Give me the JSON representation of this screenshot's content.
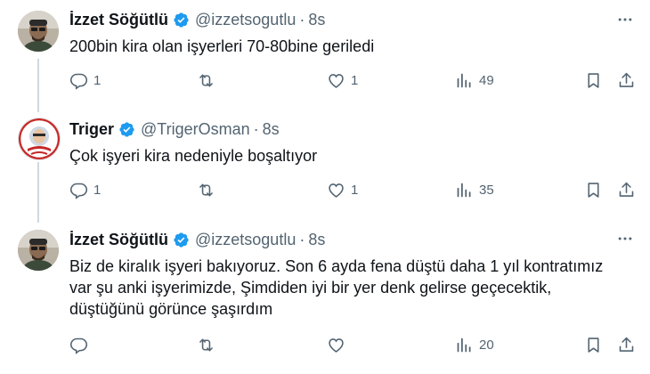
{
  "colors": {
    "verified": "#1d9bf0",
    "muted": "#536471",
    "thread_line": "#cfd9de"
  },
  "tweets": [
    {
      "name": "İzzet Söğütlü",
      "handle": "@izzetsogutlu",
      "dot": "·",
      "time": "8s",
      "text": "200bin kira olan işyerleri 70-80bine geriledi",
      "replies": "1",
      "retweets": "",
      "likes": "1",
      "views": "49"
    },
    {
      "name": "Triger",
      "handle": "@TrigerOsman",
      "dot": "·",
      "time": "8s",
      "text": "Çok işyeri kira nedeniyle boşaltıyor",
      "replies": "1",
      "retweets": "",
      "likes": "1",
      "views": "35"
    },
    {
      "name": "İzzet Söğütlü",
      "handle": "@izzetsogutlu",
      "dot": "·",
      "time": "8s",
      "text_lines": [
        "Biz de kiralık işyeri bakıyoruz. Son 6 ayda fena düştü daha 1 yıl kontratımız",
        "var şu anki işyerimizde, Şimdiden iyi bir yer denk gelirse geçecektik,",
        "düştüğünü görünce şaşırdım"
      ],
      "replies": "",
      "retweets": "",
      "likes": "",
      "views": "20"
    }
  ]
}
